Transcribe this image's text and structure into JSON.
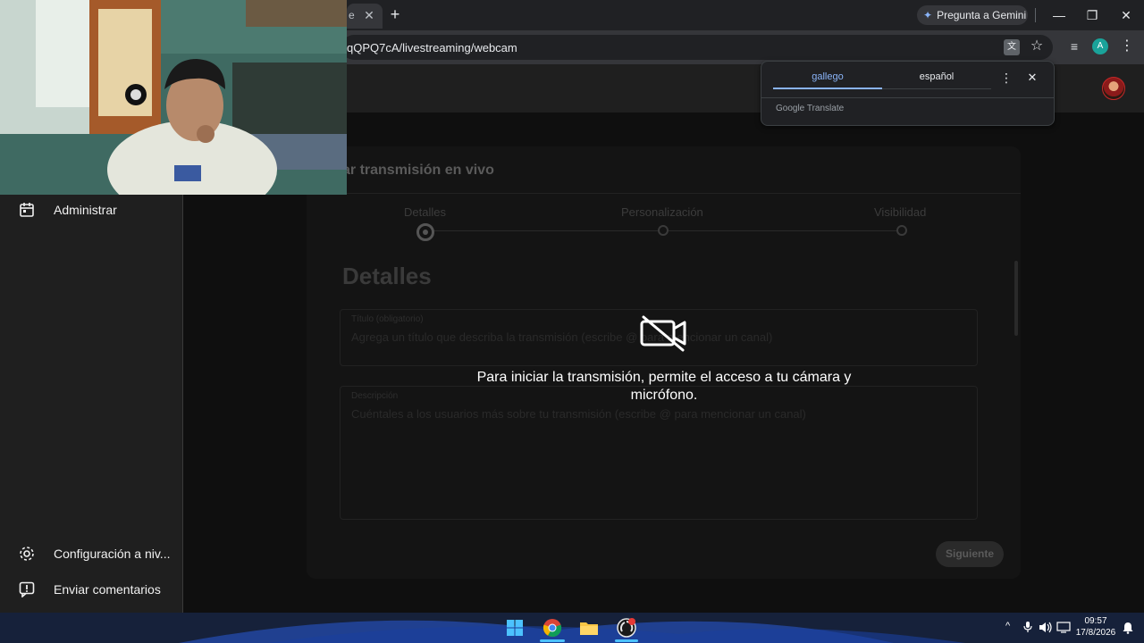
{
  "browser": {
    "tab_fragment": "e",
    "close_tab_glyph": "✕",
    "new_tab_glyph": "+",
    "gemini_label": "Pregunta a Gemini",
    "url": "qQPQ7cA/livestreaming/webcam",
    "profile_initial": "A",
    "minimize_glyph": "—",
    "restore_glyph": "❐",
    "close_glyph": "✕"
  },
  "translate_popup": {
    "source_language": "gallego",
    "target_language": "español",
    "brand": "Google Translate",
    "more_glyph": "⋮",
    "close_glyph": "✕"
  },
  "sidebar": {
    "items": [
      {
        "label": "Administrar",
        "icon": "calendar-icon"
      }
    ],
    "bottom_items": [
      {
        "label": "Configuración a niv...",
        "icon": "gear-icon"
      },
      {
        "label": "Enviar comentarios",
        "icon": "feedback-icon"
      }
    ]
  },
  "modal": {
    "title": "ar transmisión en vivo",
    "steps": [
      "Detalles",
      "Personalización",
      "Visibilidad"
    ],
    "active_step": 0,
    "section_heading": "Detalles",
    "title_field_label": "Título (obligatorio)",
    "title_field_placeholder": "Agrega un título que describa la transmisión (escribe @ para mencionar un canal)",
    "desc_field_label": "Descripción",
    "desc_field_placeholder": "Cuéntales a los usuarios más sobre tu transmisión (escribe @ para mencionar un canal)",
    "next_button": "Siguiente"
  },
  "overlay": {
    "message": "Para iniciar la transmisión, permite el acceso a tu cámara y micrófono.",
    "icon": "camera-off-icon"
  },
  "taskbar": {
    "time": "09:57",
    "date": "17/8/2026",
    "chevron_glyph": "^",
    "apps": [
      "windows-start-icon",
      "chrome-icon",
      "file-explorer-icon",
      "obs-icon"
    ]
  },
  "colors": {
    "accent": "#8ab4f8",
    "chrome_bg": "#202124",
    "studio_bg": "#0f0f0f"
  }
}
